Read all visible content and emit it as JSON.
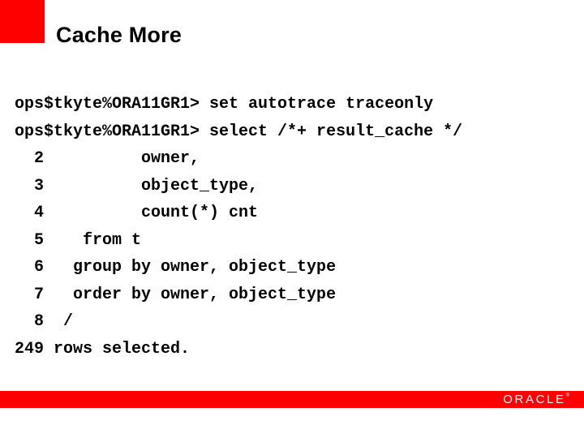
{
  "slide": {
    "title": "Cache More",
    "accent_color": "#ff0000",
    "background_color": "#ffffff",
    "text_color": "#000000"
  },
  "console": {
    "lines": [
      "ops$tkyte%ORA11GR1> set autotrace traceonly",
      "ops$tkyte%ORA11GR1> select /*+ result_cache */",
      "  2          owner,",
      "  3          object_type,",
      "  4          count(*) cnt",
      "  5    from t",
      "  6   group by owner, object_type",
      "  7   order by owner, object_type",
      "  8  /",
      "249 rows selected."
    ]
  },
  "footer": {
    "bar_color": "#ff0000",
    "logo_text": "ORACLE",
    "logo_trademark": "®"
  }
}
